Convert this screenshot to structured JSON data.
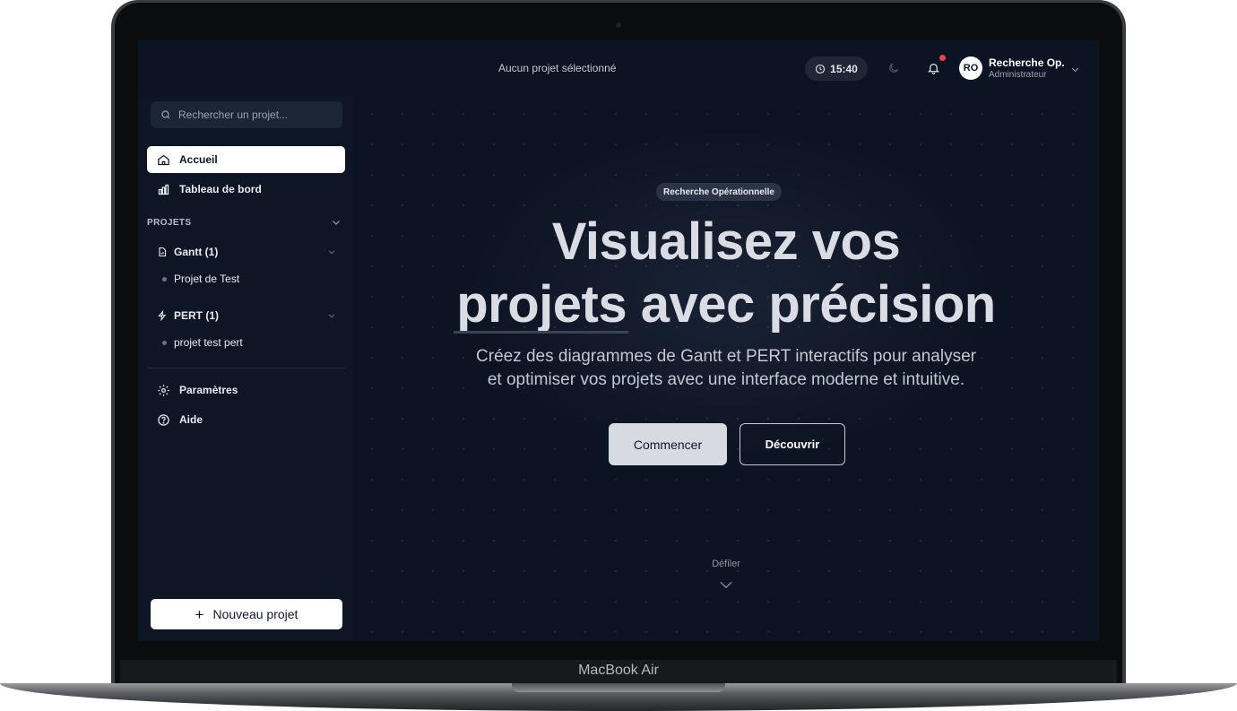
{
  "device": {
    "label": "MacBook Air"
  },
  "header": {
    "project_status": "Aucun projet sélectionné",
    "clock": "15:40",
    "notification_dot_color": "#ef4444",
    "user": {
      "initials": "RO",
      "name": "Recherche Op.",
      "role": "Administrateur"
    }
  },
  "sidebar": {
    "search": {
      "placeholder": "Rechercher un projet..."
    },
    "nav": [
      {
        "label": "Accueil",
        "icon": "home-icon",
        "active": true
      },
      {
        "label": "Tableau de bord",
        "icon": "chart-icon",
        "active": false
      }
    ],
    "projects_label": "PROJETS",
    "groups": [
      {
        "label": "Gantt (1)",
        "icon": "file-chart-icon",
        "items": [
          "Projet de Test"
        ]
      },
      {
        "label": "PERT (1)",
        "icon": "network-icon",
        "items": [
          "projet test pert"
        ]
      }
    ],
    "bottom_nav": [
      {
        "label": "Paramètres",
        "icon": "gear-icon"
      },
      {
        "label": "Aide",
        "icon": "help-icon"
      }
    ],
    "new_project_label": "Nouveau projet"
  },
  "hero": {
    "badge": "Recherche Opérationnelle",
    "title_line1": "Visualisez vos",
    "title_line2": "projets avec précision",
    "subtitle_line1": "Créez des diagrammes de Gantt et PERT interactifs pour analyser",
    "subtitle_line2": "et optimiser vos projets avec une interface moderne et intuitive.",
    "primary_button": "Commencer",
    "secondary_button": "Découvrir",
    "scroll_label": "Défiler"
  }
}
